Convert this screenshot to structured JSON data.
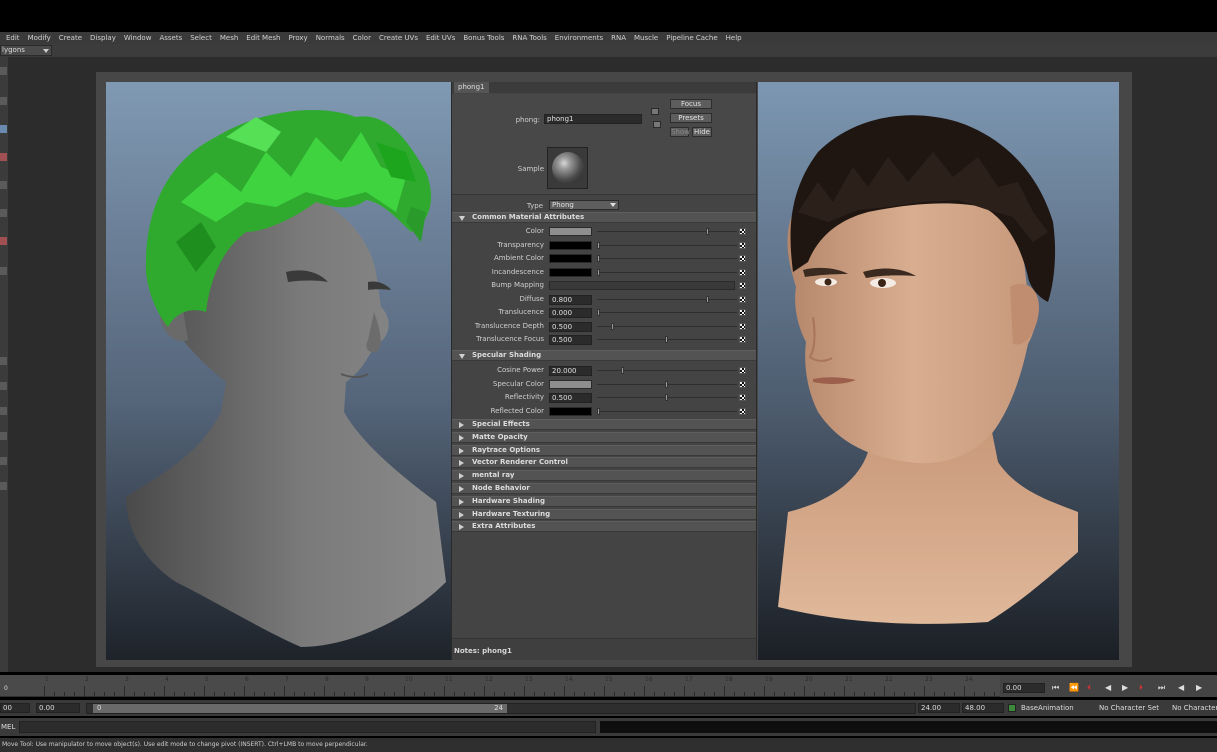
{
  "menubar": {
    "items": [
      "Edit",
      "Modify",
      "Create",
      "Display",
      "Window",
      "Assets",
      "Select",
      "Mesh",
      "Edit Mesh",
      "Proxy",
      "Normals",
      "Color",
      "Create UVs",
      "Edit UVs",
      "Bonus Tools",
      "RNA Tools",
      "Environments",
      "RNA",
      "Muscle",
      "Pipeline Cache",
      "Help"
    ]
  },
  "status": {
    "mode": "lygons"
  },
  "editor": {
    "tab_label": "phong1",
    "name_label": "phong:",
    "name_value": "phong1",
    "focus_btn": "Focus",
    "presets_btn": "Presets",
    "show_btn": "Show",
    "hide_btn": "Hide",
    "sample_label": "Sample",
    "type_label": "Type",
    "type_value": "Phong",
    "common": {
      "title": "Common Material Attributes",
      "attrs": [
        {
          "label": "Color",
          "kind": "swatch",
          "color": "#8e8e8e",
          "slider": 0.8
        },
        {
          "label": "Transparency",
          "kind": "swatch",
          "color": "#000000",
          "slider": 0.0
        },
        {
          "label": "Ambient Color",
          "kind": "swatch",
          "color": "#000000",
          "slider": 0.0
        },
        {
          "label": "Incandescence",
          "kind": "swatch",
          "color": "#000000",
          "slider": 0.0
        },
        {
          "label": "Bump Mapping",
          "kind": "slot"
        },
        {
          "label": "Diffuse",
          "kind": "num",
          "value": "0.800",
          "slider": 0.8
        },
        {
          "label": "Translucence",
          "kind": "num",
          "value": "0.000",
          "slider": 0.0
        },
        {
          "label": "Translucence Depth",
          "kind": "num",
          "value": "0.500",
          "slider": 0.1
        },
        {
          "label": "Translucence Focus",
          "kind": "num",
          "value": "0.500",
          "slider": 0.5
        }
      ]
    },
    "specular": {
      "title": "Specular Shading",
      "attrs": [
        {
          "label": "Cosine Power",
          "kind": "num",
          "value": "20.000",
          "slider": 0.18
        },
        {
          "label": "Specular Color",
          "kind": "swatch",
          "color": "#8e8e8e",
          "slider": 0.5
        },
        {
          "label": "Reflectivity",
          "kind": "num",
          "value": "0.500",
          "slider": 0.5
        },
        {
          "label": "Reflected Color",
          "kind": "swatch",
          "color": "#000000",
          "slider": 0.0
        }
      ]
    },
    "collapsed_sections": [
      "Special Effects",
      "Matte Opacity",
      "Raytrace Options",
      "Vector Renderer Control",
      "mental ray",
      "Node Behavior",
      "Hardware Shading",
      "Hardware Texturing",
      "Extra Attributes"
    ],
    "notes_label": "Notes: phong1"
  },
  "timeline": {
    "ticks": [
      "1",
      "2",
      "3",
      "4",
      "5",
      "6",
      "7",
      "8",
      "9",
      "10",
      "11",
      "12",
      "13",
      "14",
      "15",
      "16",
      "17",
      "18",
      "19",
      "20",
      "21",
      "22",
      "23",
      "24"
    ],
    "start_label": "0",
    "current_frame": "0.00"
  },
  "range": {
    "start": "00",
    "start2": "0.00",
    "slider_start": "0",
    "slider_end": "24",
    "end": "24.00",
    "end2": "48.00",
    "anim_layer": "BaseAnimation",
    "char_set": "No Character Set",
    "char_set2": "No Character S"
  },
  "cmd": {
    "label": "MEL"
  },
  "helpline": {
    "text": "Move Tool: Use manipulator to move object(s). Use edit mode to change pivot (INSERT).  Ctrl+LMB to move perpendicular."
  },
  "colors": {
    "accent": "#3a8a3a",
    "panel": "#444444",
    "viewport_top": "#8099b3"
  }
}
